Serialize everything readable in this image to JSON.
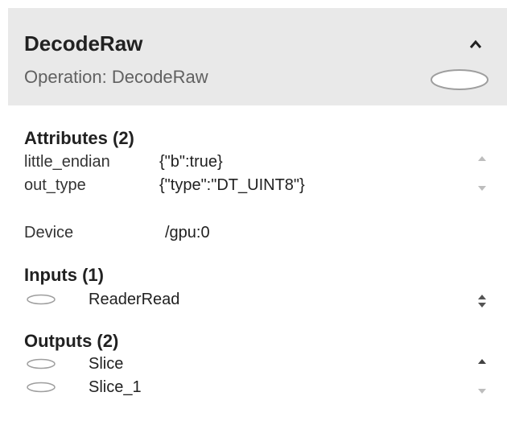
{
  "header": {
    "title": "DecodeRaw",
    "subtitle": "Operation: DecodeRaw"
  },
  "attributes": {
    "title": "Attributes (2)",
    "items": [
      {
        "key": "little_endian",
        "value": "{\"b\":true}"
      },
      {
        "key": "out_type",
        "value": "{\"type\":\"DT_UINT8\"}"
      }
    ]
  },
  "device": {
    "label": "Device",
    "value": "/gpu:0"
  },
  "inputs": {
    "title": "Inputs (1)",
    "items": [
      {
        "name": "ReaderRead"
      }
    ]
  },
  "outputs": {
    "title": "Outputs (2)",
    "items": [
      {
        "name": "Slice"
      },
      {
        "name": "Slice_1"
      }
    ]
  },
  "icons": {
    "collapse": "chevron-up-icon",
    "node": "ellipse-node-icon",
    "scroll_up": "triangle-up-icon",
    "scroll_down": "triangle-down-icon"
  },
  "colors": {
    "header_bg": "#e9e9e9",
    "title": "#212121",
    "subtitle": "#616161",
    "ellipse_stroke": "#9e9e9e"
  }
}
